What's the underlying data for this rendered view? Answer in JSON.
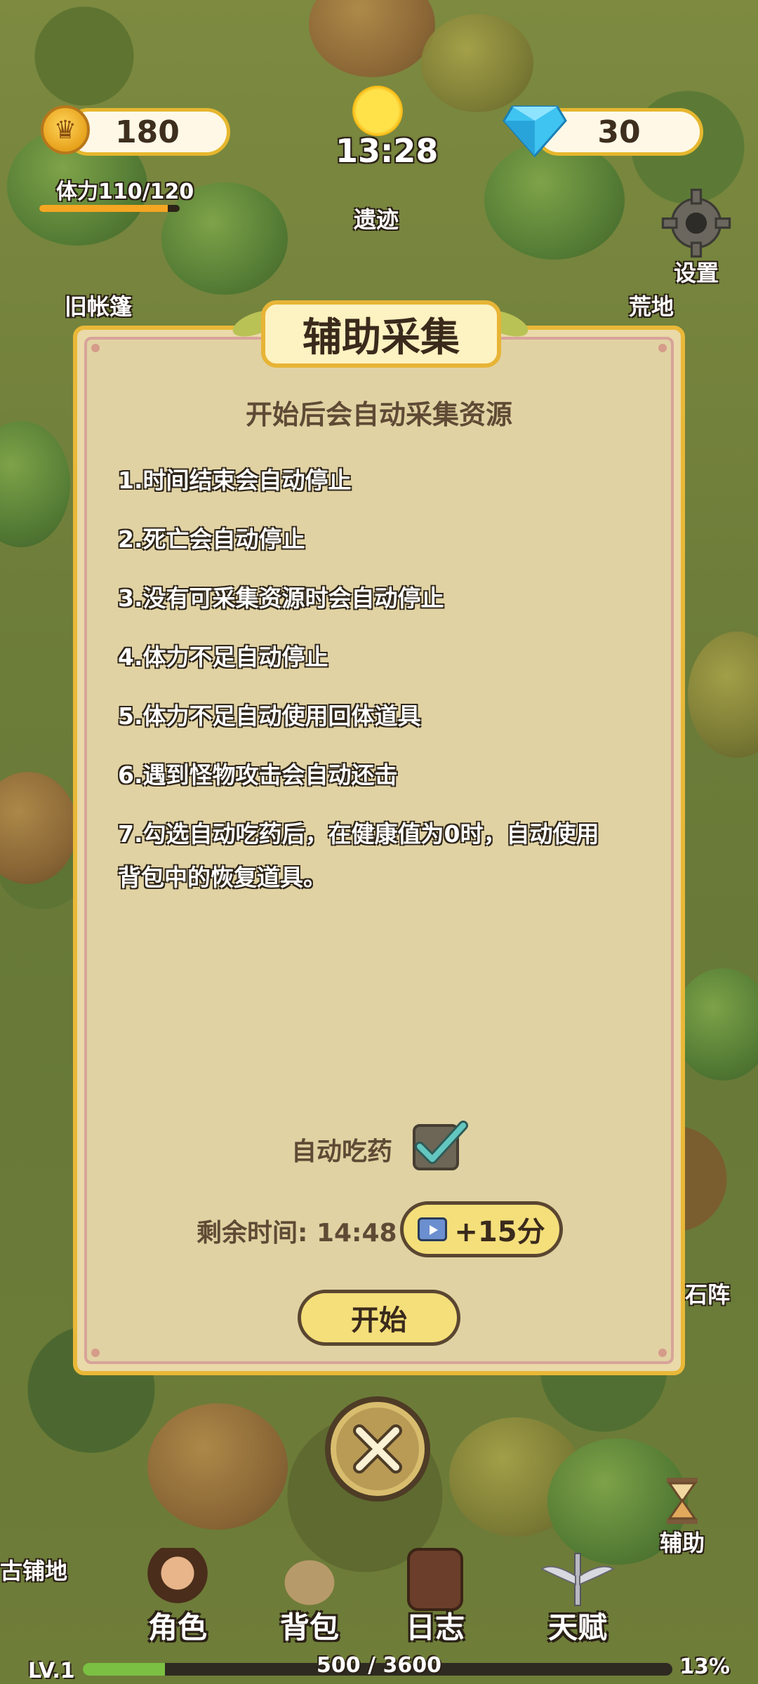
{
  "hud": {
    "coins": "180",
    "gems": "30",
    "time": "13:28",
    "stamina_label": "体力110/120",
    "stamina_fraction": 0.9167,
    "settings_label": "设置"
  },
  "map_labels": {
    "ruins": "遗迹",
    "old_tent": "旧帐篷",
    "wasteland": "荒地",
    "stone_array": "石阵",
    "shop": "古铺地"
  },
  "dialog": {
    "title": "辅助采集",
    "subtitle": "开始后会自动采集资源",
    "rules": [
      "1.时间结束会自动停止",
      "2.死亡会自动停止",
      "3.没有可采集资源时会自动停止",
      "4.体力不足自动停止",
      "5.体力不足自动使用回体道具",
      "6.遇到怪物攻击会自动还击",
      "7.勾选自动吃药后，在健康值为0时，自动使用",
      "背包中的恢复道具。"
    ],
    "auto_potion_label": "自动吃药",
    "auto_potion_checked": true,
    "remaining_label": "剩余时间:",
    "remaining_value": "14:48",
    "extend_button": "+15分",
    "start_button": "开始"
  },
  "assist_label": "辅助",
  "bottom_nav": {
    "character": "角色",
    "backpack": "背包",
    "journal": "日志",
    "talent": "天赋"
  },
  "level": {
    "label": "LV.1",
    "xp_text": "500 / 3600",
    "xp_fraction": 0.139,
    "percent": "13%"
  },
  "colors": {
    "accent_gold": "#e9b838",
    "panel_bg": "#ead9a9",
    "check_teal": "#63c7c0",
    "xp_green": "#7bc043"
  }
}
